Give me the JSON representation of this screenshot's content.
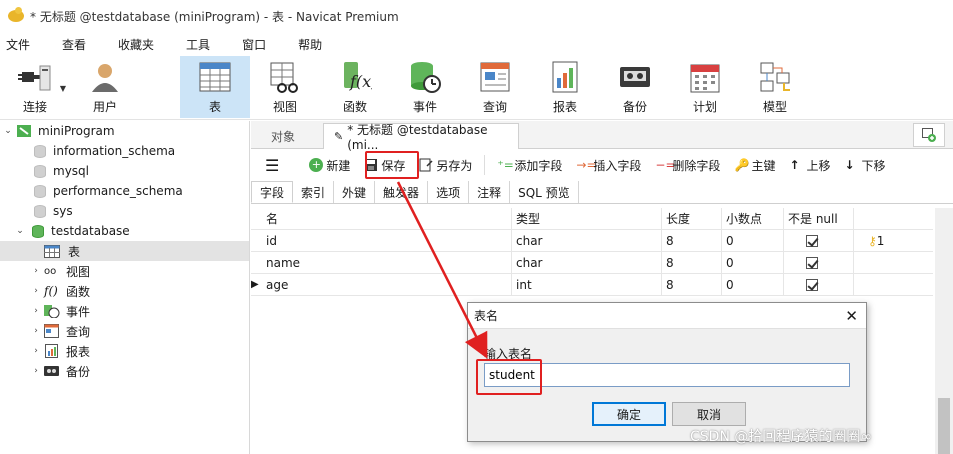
{
  "window": {
    "title": "* 无标题 @testdatabase (miniProgram) - 表 - Navicat Premium"
  },
  "menu": [
    "文件",
    "查看",
    "收藏夹",
    "工具",
    "窗口",
    "帮助"
  ],
  "toolbar": {
    "items": [
      {
        "label": "连接",
        "icon": "plug-icon"
      },
      {
        "label": "用户",
        "icon": "user-icon"
      },
      {
        "label": "表",
        "icon": "table-icon"
      },
      {
        "label": "视图",
        "icon": "view-icon"
      },
      {
        "label": "函数",
        "icon": "function-icon"
      },
      {
        "label": "事件",
        "icon": "event-icon"
      },
      {
        "label": "查询",
        "icon": "query-icon"
      },
      {
        "label": "报表",
        "icon": "report-icon"
      },
      {
        "label": "备份",
        "icon": "backup-icon"
      },
      {
        "label": "计划",
        "icon": "calendar-icon"
      },
      {
        "label": "模型",
        "icon": "model-icon"
      }
    ]
  },
  "sidebar": {
    "connection": "miniProgram",
    "databases": [
      "information_schema",
      "mysql",
      "performance_schema",
      "sys",
      "testdatabase"
    ],
    "children": [
      "表",
      "视图",
      "函数",
      "事件",
      "查询",
      "报表",
      "备份"
    ]
  },
  "tabs": {
    "object": "对象",
    "current": "* 无标题 @testdatabase (mi..."
  },
  "editor_toolbar": {
    "new": "新建",
    "save": "保存",
    "save_as": "另存为",
    "add_field": "添加字段",
    "insert_field": "插入字段",
    "delete_field": "删除字段",
    "primary_key": "主键",
    "move_up": "上移",
    "move_down": "下移"
  },
  "subtabs": [
    "字段",
    "索引",
    "外键",
    "触发器",
    "选项",
    "注释",
    "SQL 预览"
  ],
  "grid": {
    "headers": [
      "名",
      "类型",
      "长度",
      "小数点",
      "不是 null",
      ""
    ],
    "rows": [
      {
        "name": "id",
        "type": "char",
        "length": "8",
        "decimals": "0",
        "key": "1"
      },
      {
        "name": "name",
        "type": "char",
        "length": "8",
        "decimals": "0",
        "key": ""
      },
      {
        "name": "age",
        "type": "int",
        "length": "8",
        "decimals": "0",
        "key": ""
      }
    ]
  },
  "dialog": {
    "title": "表名",
    "prompt": "输入表名",
    "value": "student",
    "ok": "确定",
    "cancel": "取消"
  },
  "watermark": "CSDN @拾回程序猿的圈圈∞",
  "colors": {
    "selection": "#cce4f7",
    "annotation": "#e02020"
  }
}
